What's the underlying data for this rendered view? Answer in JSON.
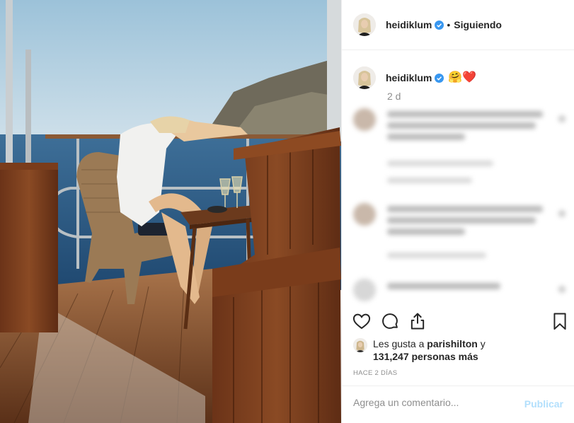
{
  "header": {
    "username": "heidiklum",
    "separator": "•",
    "follow_status": "Siguiendo"
  },
  "caption": {
    "username": "heidiklum",
    "emojis": "🤗❤️",
    "time_ago": "2 d"
  },
  "actions": {
    "icons": [
      "heart-outline-icon",
      "comment-bubble-icon",
      "share-upload-icon",
      "bookmark-icon"
    ]
  },
  "likes": {
    "prefix": "Les gusta a ",
    "user": "parishilton",
    "joiner": " y",
    "count": "131,247",
    "suffix": "personas más"
  },
  "date": "Hace 2 días",
  "comment_box": {
    "placeholder": "Agrega un comentario...",
    "publish_label": "Publicar"
  },
  "colors": {
    "verified": "#3897f0",
    "publish_disabled": "#b2dffc",
    "muted_text": "#8e8e8e"
  }
}
